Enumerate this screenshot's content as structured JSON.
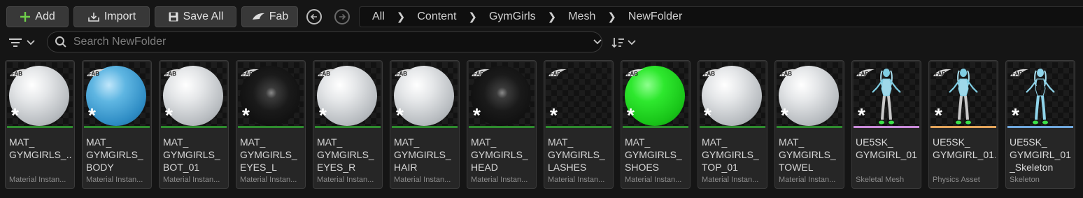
{
  "toolbar": {
    "add_label": "Add",
    "import_label": "Import",
    "save_all_label": "Save All",
    "fab_label": "Fab"
  },
  "breadcrumb": [
    "All",
    "Content",
    "GymGirls",
    "Mesh",
    "NewFolder"
  ],
  "search": {
    "placeholder": "Search NewFolder",
    "value": ""
  },
  "colors": {
    "material": "#2e8b2e",
    "skeletal_mesh": "#c88ad8",
    "physics_asset": "#e2a35a",
    "skeleton": "#6fa7dc",
    "add_accent": "#6fcf4a"
  },
  "assets": [
    {
      "name": "MAT_\nGYMGIRLS_...",
      "type": "Material Instan...",
      "preview": "sphere",
      "sphere_color": "white"
    },
    {
      "name": "MAT_\nGYMGIRLS_\nBODY",
      "type": "Material Instan...",
      "preview": "sphere",
      "sphere_color": "blue"
    },
    {
      "name": "MAT_\nGYMGIRLS_\nBOT_01",
      "type": "Material Instan...",
      "preview": "sphere",
      "sphere_color": "white"
    },
    {
      "name": "MAT_\nGYMGIRLS_\nEYES_L",
      "type": "Material Instan...",
      "preview": "sphere",
      "sphere_color": "black"
    },
    {
      "name": "MAT_\nGYMGIRLS_\nEYES_R",
      "type": "Material Instan...",
      "preview": "sphere",
      "sphere_color": "white"
    },
    {
      "name": "MAT_\nGYMGIRLS_\nHAIR",
      "type": "Material Instan...",
      "preview": "sphere",
      "sphere_color": "white"
    },
    {
      "name": "MAT_\nGYMGIRLS_\nHEAD",
      "type": "Material Instan...",
      "preview": "sphere",
      "sphere_color": "black"
    },
    {
      "name": "MAT_\nGYMGIRLS_\nLASHES",
      "type": "Material Instan...",
      "preview": "empty",
      "sphere_color": ""
    },
    {
      "name": "MAT_\nGYMGIRLS_\nSHOES",
      "type": "Material Instan...",
      "preview": "sphere",
      "sphere_color": "green"
    },
    {
      "name": "MAT_\nGYMGIRLS_\nTOP_01",
      "type": "Material Instan...",
      "preview": "sphere",
      "sphere_color": "white"
    },
    {
      "name": "MAT_\nGYMGIRLS_\nTOWEL",
      "type": "Material Instan...",
      "preview": "sphere",
      "sphere_color": "white"
    },
    {
      "name": "UE5SK_\nGYMGIRL_01",
      "type": "Skeletal Mesh",
      "preview": "character",
      "sphere_color": ""
    },
    {
      "name": "UE5SK_\nGYMGIRL_01...",
      "type": "Physics Asset",
      "preview": "character",
      "sphere_color": ""
    },
    {
      "name": "UE5SK_\nGYMGIRL_01\n_Skeleton",
      "type": "Skeleton",
      "preview": "skeleton",
      "sphere_color": ""
    }
  ]
}
